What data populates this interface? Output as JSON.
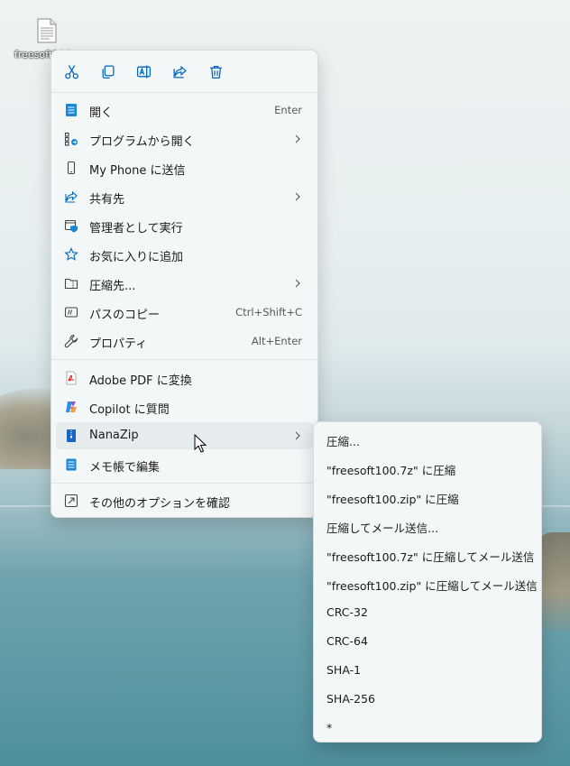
{
  "desktop": {
    "file_label": "freesoft100"
  },
  "toolbar": [
    {
      "name": "cut-icon"
    },
    {
      "name": "copy-icon"
    },
    {
      "name": "rename-icon"
    },
    {
      "name": "share-icon"
    },
    {
      "name": "delete-icon"
    }
  ],
  "menu": {
    "open": {
      "label": "開く",
      "shortcut": "Enter"
    },
    "open_with": {
      "label": "プログラムから開く"
    },
    "send_phone": {
      "label": "My Phone に送信"
    },
    "share_to": {
      "label": "共有先"
    },
    "run_admin": {
      "label": "管理者として実行"
    },
    "add_fav": {
      "label": "お気に入りに追加"
    },
    "compress_to": {
      "label": "圧縮先..."
    },
    "copy_path": {
      "label": "パスのコピー",
      "shortcut": "Ctrl+Shift+C"
    },
    "properties": {
      "label": "プロパティ",
      "shortcut": "Alt+Enter"
    },
    "adobe_pdf": {
      "label": "Adobe PDF に変換"
    },
    "copilot": {
      "label": "Copilot に質問"
    },
    "nanazip": {
      "label": "NanaZip"
    },
    "notepad": {
      "label": "メモ帳で編集"
    },
    "more_options": {
      "label": "その他のオプションを確認"
    }
  },
  "submenu": [
    "圧縮...",
    "\"freesoft100.7z\" に圧縮",
    "\"freesoft100.zip\" に圧縮",
    "圧縮してメール送信...",
    "\"freesoft100.7z\" に圧縮してメール送信",
    "\"freesoft100.zip\" に圧縮してメール送信",
    "CRC-32",
    "CRC-64",
    "SHA-1",
    "SHA-256",
    "*"
  ],
  "colors": {
    "accent": "#0067c0",
    "menu_bg": "#f3f7f8"
  }
}
